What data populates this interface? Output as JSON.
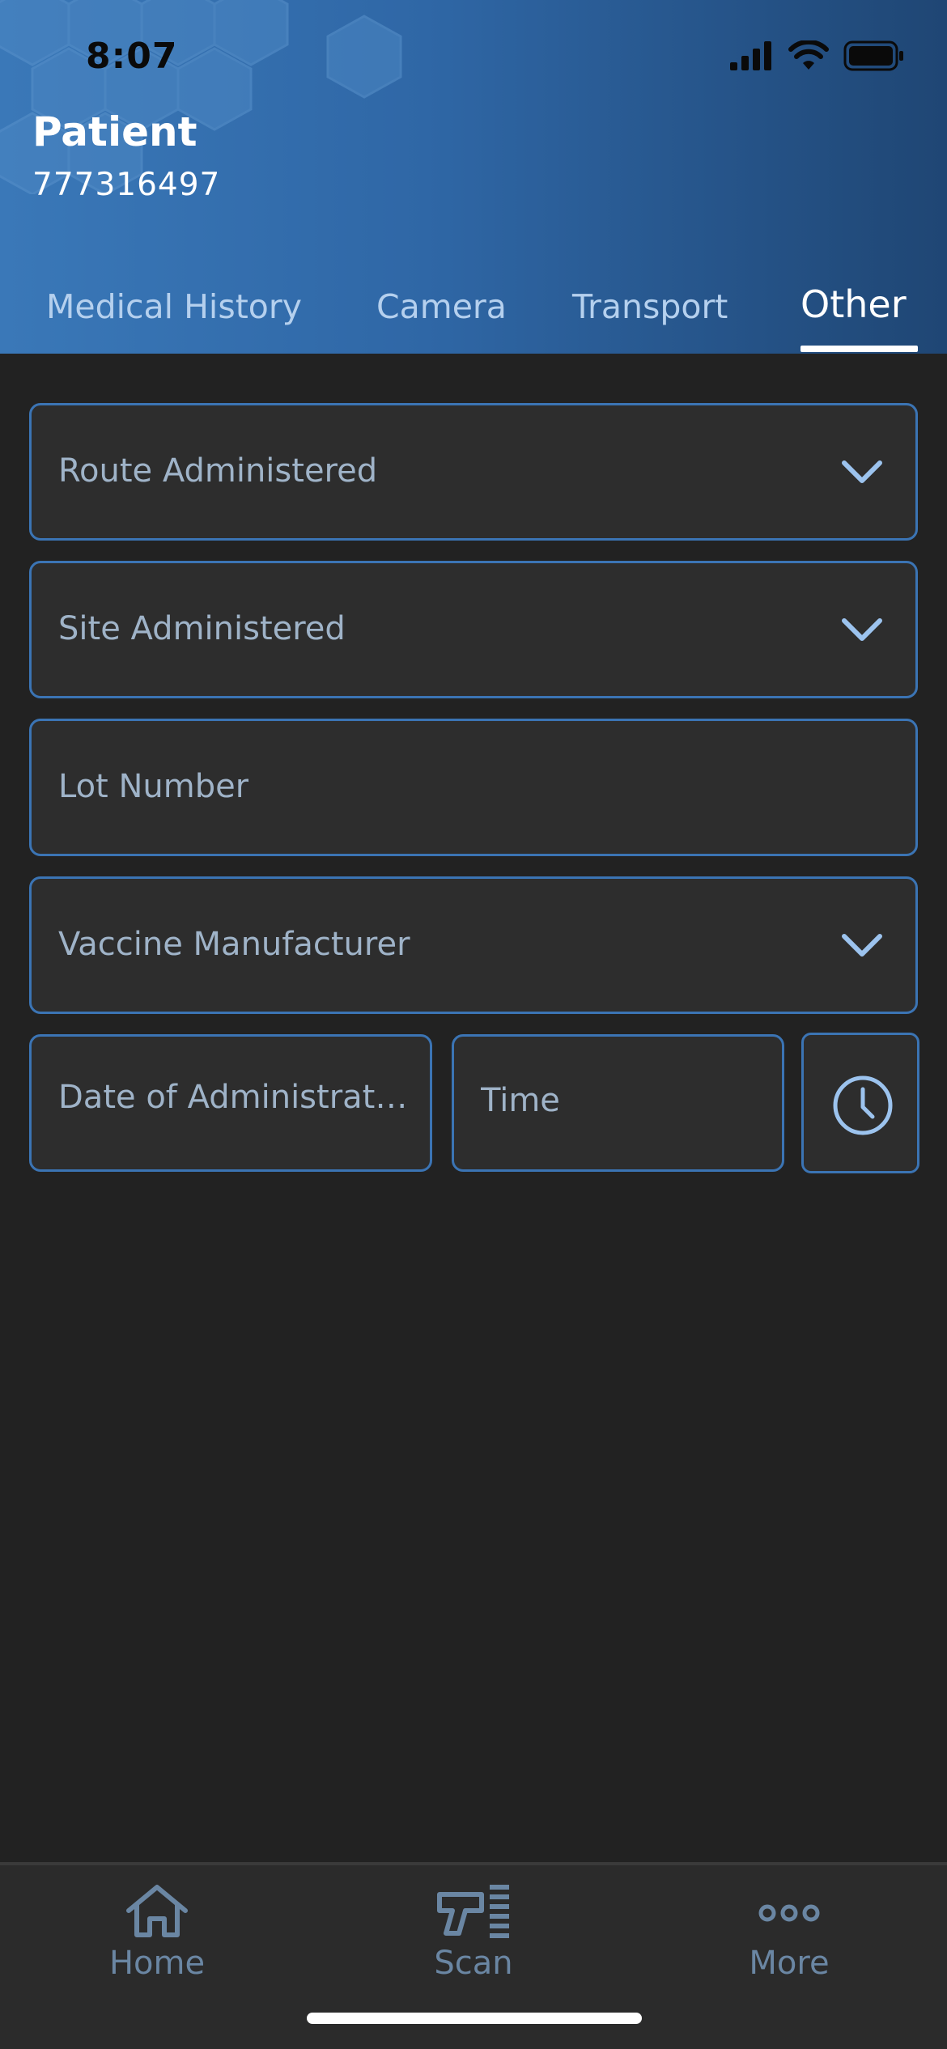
{
  "status_bar": {
    "time": "8:07"
  },
  "header": {
    "title": "Patient",
    "patient_id": "777316497"
  },
  "tabs": [
    {
      "label": "Medical History",
      "active": false
    },
    {
      "label": "Camera",
      "active": false
    },
    {
      "label": "Transport",
      "active": false
    },
    {
      "label": "Other",
      "active": true
    }
  ],
  "form": {
    "route_administered": {
      "placeholder": "Route Administered",
      "icon": "chevron-down-icon"
    },
    "site_administered": {
      "placeholder": "Site Administered",
      "icon": "chevron-down-icon"
    },
    "lot_number": {
      "placeholder": "Lot Number"
    },
    "vaccine_manufacturer": {
      "placeholder": "Vaccine Manufacturer",
      "icon": "chevron-down-icon"
    },
    "date_of_administration": {
      "placeholder": "Date of Administrati…"
    },
    "time": {
      "placeholder": "Time"
    },
    "clock_button": {
      "icon": "clock-icon"
    }
  },
  "bottom_nav": [
    {
      "label": "Home",
      "icon": "home-icon"
    },
    {
      "label": "Scan",
      "icon": "barcode-scanner-icon"
    },
    {
      "label": "More",
      "icon": "more-dots-icon"
    }
  ],
  "colors": {
    "accent": "#3b74b4",
    "background": "#222222",
    "field_bg": "#2d2d2d",
    "header_gradient_start": "#3a78b8",
    "header_gradient_end": "#1f4674",
    "nav_inactive": "#6a86a3"
  }
}
